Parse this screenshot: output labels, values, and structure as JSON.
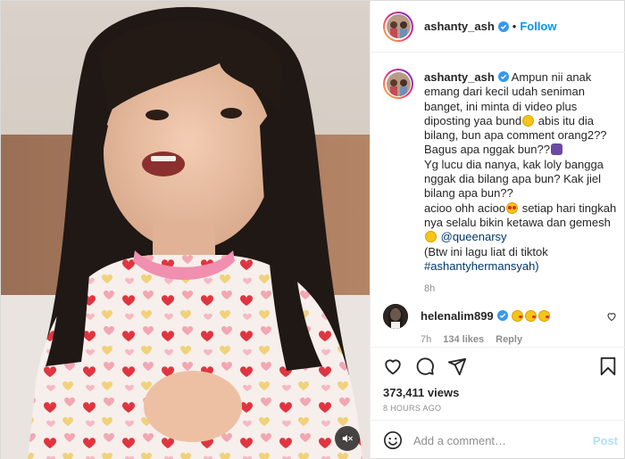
{
  "header": {
    "username": "ashanty_ash",
    "separator": "•",
    "follow_label": "Follow"
  },
  "caption": {
    "username": "ashanty_ash",
    "line1": "Ampun nii anak emang dari kecil udah seniman banget, ini minta di video plus diposting yaa bund",
    "line2": "abis itu dia bilang, bun apa comment orang2?? Bagus apa nggak bun??",
    "line3": "Yg lucu dia nanya, kak loly bangga nggak dia bilang apa bun? Kak jiel bilang apa bun??",
    "line4": "acioo ohh acioo",
    "line5": "setiap hari tingkah nya selalu bikin ketawa dan gemesh",
    "mention": "@queenarsy",
    "line6": "(Btw ini lagu liat di tiktok",
    "hashtag": "#ashantyhermansyah)",
    "time": "8h"
  },
  "reply": {
    "username": "helenalim899",
    "time": "7h",
    "likes": "134 likes",
    "reply_label": "Reply"
  },
  "stats": {
    "views": "373,411 views",
    "posted": "8 HOURS AGO"
  },
  "comment_box": {
    "placeholder": "Add a comment…",
    "post_label": "Post"
  },
  "icons": {
    "verified": "verified-badge-icon",
    "like": "heart-icon",
    "comment": "comment-icon",
    "share": "share-icon",
    "save": "bookmark-icon",
    "emoji": "smile-icon",
    "mute": "speaker-muted-icon"
  },
  "colors": {
    "accent": "#0095f6",
    "link": "#00376b",
    "muted": "#8e8e8e",
    "post_disabled": "#b2dffc"
  }
}
